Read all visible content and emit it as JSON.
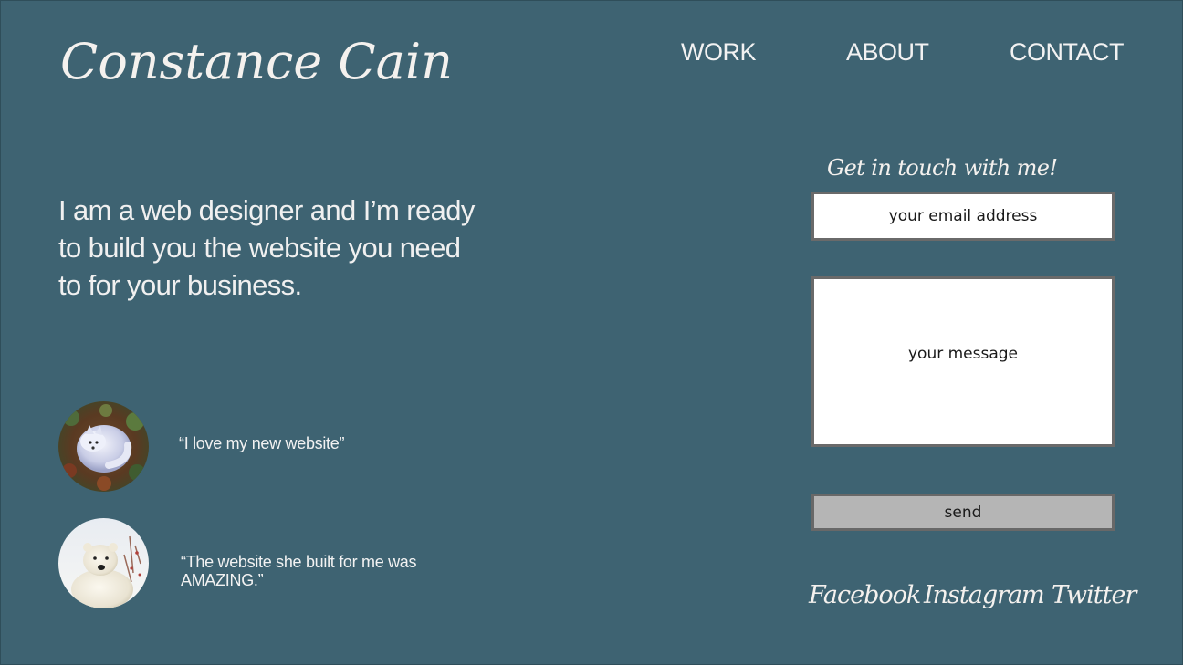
{
  "brand": {
    "name": "Constance Cain"
  },
  "nav": {
    "work": "WORK",
    "about": "ABOUT",
    "contact": "CONTACT"
  },
  "hero": {
    "tagline": "I am a web designer and I’m ready to build you the website you need to for your business."
  },
  "testimonials": [
    {
      "quote": "“I love my new website”",
      "avatar": "arctic-fox-photo"
    },
    {
      "quote": "“The website she built for me was AMAZING.”",
      "avatar": "polar-bear-photo"
    }
  ],
  "contact_form": {
    "heading": "Get in touch with me!",
    "email_placeholder": "your email address",
    "message_placeholder": "your message",
    "send_label": "send"
  },
  "social": {
    "facebook": "Facebook",
    "instagram": "Instagram",
    "twitter": "Twitter"
  },
  "colors": {
    "background": "#3e6372",
    "text": "#f1f1f1",
    "field_bg": "#ffffff",
    "field_border": "#6a6a6a",
    "button_bg": "#b5b5b5"
  }
}
